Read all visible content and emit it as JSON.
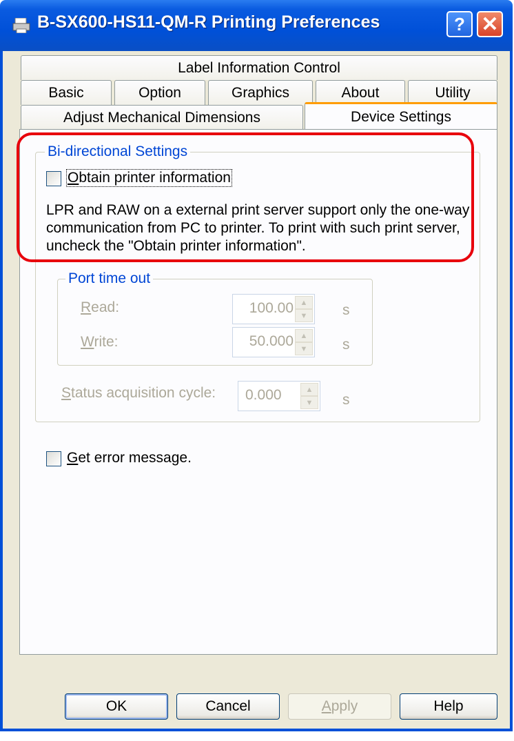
{
  "window": {
    "title": "B-SX600-HS11-QM-R Printing Preferences",
    "help_glyph": "?",
    "close_glyph": "✕"
  },
  "tabs": {
    "row1": [
      {
        "label": "Label Information Control"
      }
    ],
    "row2": [
      {
        "label": "Basic"
      },
      {
        "label": "Option"
      },
      {
        "label": "Graphics"
      },
      {
        "label": "About"
      },
      {
        "label": "Utility"
      }
    ],
    "row3": [
      {
        "label": "Adjust Mechanical Dimensions"
      },
      {
        "label": "Device Settings",
        "active": true
      }
    ]
  },
  "bidirectional": {
    "legend": "Bi-directional Settings",
    "obtain_info": {
      "mnemonic": "O",
      "rest": "btain printer information",
      "checked": false
    },
    "note": "LPR and RAW on a external print server support only the one-way communication from PC to printer. To print with such print server, uncheck the \"Obtain printer information\"."
  },
  "port_timeout": {
    "legend": "Port time out",
    "read": {
      "mnemonic": "R",
      "rest": "ead:",
      "value": "100.00",
      "unit": "s"
    },
    "write": {
      "mnemonic": "W",
      "rest": "rite:",
      "value": "50.000",
      "unit": "s"
    }
  },
  "status_cycle": {
    "mnemonic": "S",
    "rest": "tatus acquisition cycle:",
    "value": "0.000",
    "unit": "s"
  },
  "error_message": {
    "mnemonic": "G",
    "rest": "et error message.",
    "checked": false
  },
  "buttons": {
    "ok": "OK",
    "cancel": "Cancel",
    "apply_mnemonic": "A",
    "apply_rest": "pply",
    "help": "Help"
  },
  "colors": {
    "highlight": "#e8000c",
    "titlebar": "#0050d8",
    "disabled_text": "#aca899",
    "active_tab_accent": "#ff9c00"
  }
}
